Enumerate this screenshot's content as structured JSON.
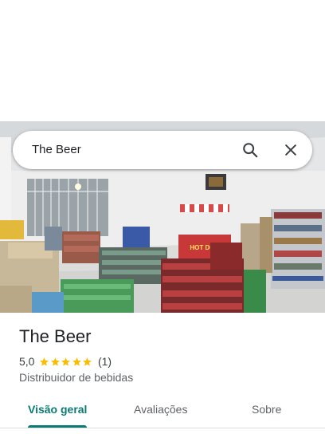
{
  "search": {
    "query": "The Beer"
  },
  "place": {
    "name": "The Beer",
    "rating": "5,0",
    "review_count": "(1)",
    "stars": 5,
    "category": "Distribuidor de bebidas"
  },
  "photo": {
    "sign_text": "HOT DOG"
  },
  "tabs": [
    {
      "label": "Visão geral",
      "active": true
    },
    {
      "label": "Avaliações",
      "active": false
    },
    {
      "label": "Sobre",
      "active": false
    }
  ],
  "colors": {
    "accent": "#0b7a75",
    "star": "#fbbc04"
  },
  "icons": {
    "search": "search-icon",
    "close": "close-icon",
    "star": "star-icon"
  }
}
